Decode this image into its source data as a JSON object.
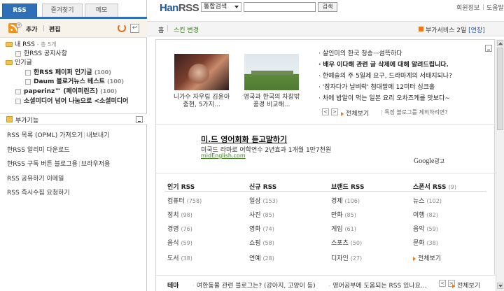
{
  "tabs": [
    {
      "label": "RSS"
    },
    {
      "label": "즐겨찾기"
    },
    {
      "label": "메모"
    }
  ],
  "toolbar": {
    "add": "추가",
    "edit": "편집",
    "back_glyph": "↩"
  },
  "tree": {
    "root": {
      "label": "내 RSS",
      "meta": "- 총 5개"
    },
    "items": [
      {
        "label": "한RSS 공지사항",
        "count": ""
      },
      {
        "label": "인기글",
        "count": ""
      },
      {
        "label": "한RSS 페이퍼 인기글",
        "count": "(100)"
      },
      {
        "label": "Daum 블로거뉴스 베스트",
        "count": "(100)"
      },
      {
        "label": "paperinz™ (페이퍼린즈)",
        "count": "(100)"
      },
      {
        "label": "소셜미디어 넘어 나눔으로 <소셜미디어",
        "count": ""
      }
    ]
  },
  "addons": {
    "title": "부가기능",
    "items": [
      {
        "a": "RSS 목록 (OPML) 가져오기",
        "b": "내보내기"
      },
      {
        "a": "한RSS 알리미 다운로드",
        "b": ""
      },
      {
        "a": "한RSS 구독 버튼 블로그용",
        "b": "브라우저용"
      },
      {
        "a": "RSS 공유하기 이메일",
        "b": ""
      },
      {
        "a": "RSS 즉시수집 요청하기",
        "b": ""
      }
    ]
  },
  "header": {
    "logo_a": "Han",
    "logo_b": "RSS",
    "search_scope": "통합검색",
    "search_value": "",
    "search_button": "검색",
    "links": [
      "회원정보",
      "도움말"
    ]
  },
  "nav": {
    "home": "홈",
    "skin": "스킨 변경",
    "premium": "부가서비스 2일",
    "extend": "[연장]"
  },
  "featured": {
    "thumbs": [
      {
        "caption": "니가수 자우림 김윤아 중현, 5가지..."
      },
      {
        "caption": "영국과 한국의 차창밖 풍경 비교해..."
      }
    ],
    "news": [
      {
        "text": "살인미의 한국 청송···섬뜩하다"
      },
      {
        "text": "배우 이다해 관련 글 삭제에 대해 알려드립니다."
      },
      {
        "text": "한예슬의 주 5일제 요구, 드라마계의 서태지되나?"
      },
      {
        "text": "'잠자다가 날벼락' 첨대말에 12미터 싱크홀"
      },
      {
        "text": "차에 밥알이 먹는 일본 요리 오차즈케를 맛보다~"
      }
    ],
    "view_all": "전체보기",
    "notice": "특정 블로그를 제외하려면?"
  },
  "ad": {
    "title": "미.드 영어회화 듣고말하기",
    "desc": "미국드 라마로 어학연수 2년효과 1개월 1만7천원",
    "url": "midEnglish.com",
    "google": "Google",
    "google_suffix": "광고"
  },
  "categories": [
    {
      "header": "인기 RSS",
      "count": "",
      "items": [
        {
          "label": "컴퓨터",
          "count": "(758)"
        },
        {
          "label": "정치",
          "count": "(98)"
        },
        {
          "label": "경영",
          "count": "(76)"
        },
        {
          "label": "음식",
          "count": "(59)"
        },
        {
          "label": "도서",
          "count": "(38)"
        }
      ]
    },
    {
      "header": "신규 RSS",
      "count": "",
      "items": [
        {
          "label": "일상",
          "count": "(153)"
        },
        {
          "label": "사진",
          "count": "(85)"
        },
        {
          "label": "영화",
          "count": "(74)"
        },
        {
          "label": "쇼핑",
          "count": "(58)"
        },
        {
          "label": "연예",
          "count": "(28)"
        }
      ]
    },
    {
      "header": "브랜드 RSS",
      "count": "",
      "items": [
        {
          "label": "경제",
          "count": "(106)"
        },
        {
          "label": "만화",
          "count": "(85)"
        },
        {
          "label": "게임",
          "count": "(61)"
        },
        {
          "label": "스포츠",
          "count": "(50)"
        },
        {
          "label": "디자인",
          "count": "(27)"
        }
      ]
    },
    {
      "header": "스폰서 RSS",
      "count": "(9)",
      "items": [
        {
          "label": "뉴스",
          "count": "(102)"
        },
        {
          "label": "여행",
          "count": "(82)"
        },
        {
          "label": "음악",
          "count": "(59)"
        },
        {
          "label": "문화",
          "count": "(38)"
        }
      ]
    }
  ],
  "theme": {
    "label": "테마",
    "items": [
      {
        "text": "여한동물 관련 블로그는? (강아지, 고양이 등)"
      },
      {
        "text": "영어공부에 도움되는 RSS 있나요..."
      }
    ],
    "view_all": "전체보기"
  },
  "colors": {
    "accent": "#2f6fb8",
    "brand": "#1e5aa8",
    "highlight": "#e8791d"
  }
}
